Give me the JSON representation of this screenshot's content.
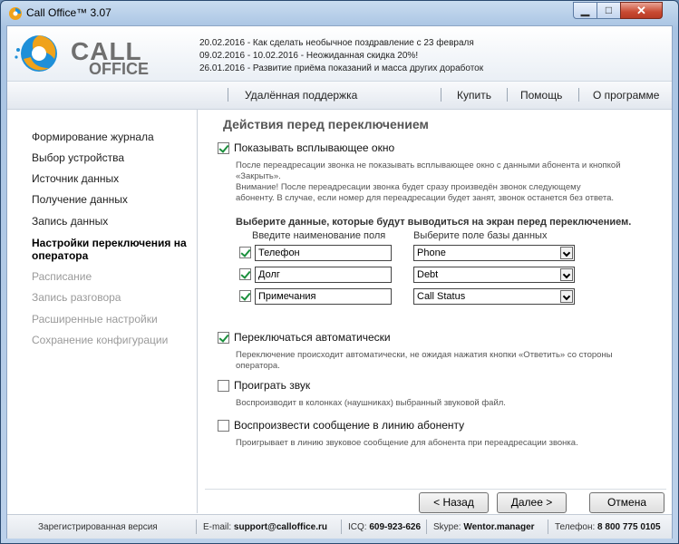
{
  "window": {
    "title": "Call Office™ 3.07",
    "min_symbol": "▁",
    "max_symbol": "□",
    "close_symbol": "✕"
  },
  "logo": {
    "line1": "CALL",
    "line2": "OFFICE"
  },
  "news": [
    "20.02.2016 - Как сделать необычное поздравление с 23 февраля",
    "09.02.2016 - 10.02.2016 - Неожиданная скидка 20%!",
    "26.01.2016 - Развитие приёма показаний и масса других доработок"
  ],
  "nav": {
    "remote": "Удалённая поддержка",
    "buy": "Купить",
    "help": "Помощь",
    "about": "О программе"
  },
  "sidebar": {
    "items": [
      "Формирование журнала",
      "Выбор устройства",
      "Источник данных",
      "Получение данных",
      "Запись данных",
      "Настройки переключения на",
      "оператора",
      "Расписание",
      "Запись разговора",
      "Расширенные настройки",
      "Сохранение конфигурации"
    ]
  },
  "content": {
    "heading": "Действия перед переключением",
    "popup": {
      "label": "Показывать всплывающее окно",
      "desc1": "После переадресации звонка не показывать всплывающее окно с данными абонента и кнопкой",
      "desc2": "«Закрыть».",
      "desc3": "Внимание! После переадресации звонка будет сразу произведён звонок следующему",
      "desc4": "абоненту. В случае, если номер для переадресации будет занят, звонок останется без ответа."
    },
    "select_heading": "Выберите данные, которые будут выводиться на экран перед переключением.",
    "col_name": "Введите наименование поля",
    "col_db": "Выберите поле базы данных",
    "rows": [
      {
        "name": "Телефон",
        "db": "Phone"
      },
      {
        "name": "Долг",
        "db": "Debt"
      },
      {
        "name": "Примечания",
        "db": "Call Status"
      }
    ],
    "auto": {
      "label": "Переключаться автоматически",
      "desc1": "Переключение происходит автоматически, не ожидая нажатия кнопки «Ответить» со стороны",
      "desc2": "оператора."
    },
    "sound": {
      "label": "Проиграть звук",
      "desc": "Воспроизводит в колонках (наушниках) выбранный звуковой файл."
    },
    "message": {
      "label": "Воспроизвести сообщение в линию абоненту",
      "desc": "Проигрывает в линию звуковое сообщение для абонента при переадресации звонка."
    }
  },
  "buttons": {
    "back": "< Назад",
    "next": "Далее >",
    "cancel": "Отмена"
  },
  "status": {
    "registered": "Зарегистрированная версия",
    "email_label": "E-mail:",
    "email": "support@calloffice.ru",
    "icq_label": "ICQ:",
    "icq": "609-923-626",
    "skype_label": "Skype:",
    "skype": "Wentor.manager",
    "phone_label": "Телефон:",
    "phone": "8 800 775 0105"
  },
  "icons": {
    "app": "call-office-logo-icon",
    "dropdown": "chevron-down-icon",
    "check": "checkmark-icon"
  },
  "colors": {
    "accent_blue": "#1e8fd8",
    "accent_orange": "#f0a21a",
    "check_green": "#1a8f3c"
  }
}
